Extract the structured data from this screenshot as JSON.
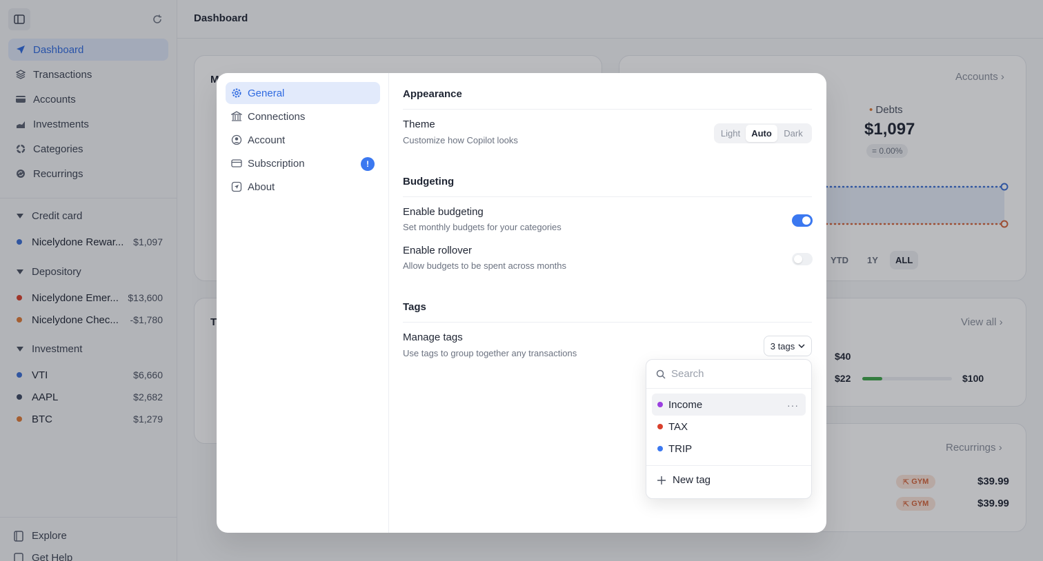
{
  "sidebar": {
    "nav": [
      {
        "label": "Dashboard",
        "active": true,
        "icon": "navigation-arrow-icon"
      },
      {
        "label": "Transactions",
        "active": false,
        "icon": "stack-icon"
      },
      {
        "label": "Accounts",
        "active": false,
        "icon": "card-icon"
      },
      {
        "label": "Investments",
        "active": false,
        "icon": "chart-icon"
      },
      {
        "label": "Categories",
        "active": false,
        "icon": "pie-icon"
      },
      {
        "label": "Recurrings",
        "active": false,
        "icon": "recurring-icon"
      }
    ],
    "groups": [
      {
        "label": "Credit card",
        "accounts": [
          {
            "name": "Nicelydone Rewar...",
            "amount": "$1,097",
            "color": "#3b6fd4"
          }
        ]
      },
      {
        "label": "Depository",
        "accounts": [
          {
            "name": "Nicelydone Emer...",
            "amount": "$13,600",
            "color": "#d9402c"
          },
          {
            "name": "Nicelydone Chec...",
            "amount": "-$1,780",
            "color": "#e07a35"
          }
        ]
      },
      {
        "label": "Investment",
        "accounts": [
          {
            "name": "VTI",
            "amount": "$6,660",
            "color": "#3b6fd4"
          },
          {
            "name": "AAPL",
            "amount": "$2,682",
            "color": "#3e4a63"
          },
          {
            "name": "BTC",
            "amount": "$1,279",
            "color": "#e07a35"
          }
        ]
      }
    ],
    "footer": [
      {
        "label": "Explore",
        "icon": "book-icon"
      },
      {
        "label": "Get Help",
        "icon": "help-icon"
      }
    ]
  },
  "header": {
    "title": "Dashboard"
  },
  "background": {
    "card1_title_fragment": "M",
    "card3_title_fragment": "T",
    "accounts_link": "Accounts",
    "debts_label": "Debts",
    "debts_value": "$1,097",
    "debts_change": "= 0.00%",
    "range_tabs": [
      "YTD",
      "1Y",
      "ALL"
    ],
    "view_all": "View all",
    "budget_values": [
      "$40",
      "$22",
      "$100"
    ],
    "recurrings_link": "Recurrings",
    "recurring_rows": [
      {
        "tag": "GYM",
        "amount": "$39.99"
      },
      {
        "tag": "GYM",
        "amount": "$39.99"
      }
    ]
  },
  "modal": {
    "menu": [
      {
        "label": "General",
        "active": true,
        "icon": "gear-icon"
      },
      {
        "label": "Connections",
        "active": false,
        "icon": "bank-icon"
      },
      {
        "label": "Account",
        "active": false,
        "icon": "user-circle-icon"
      },
      {
        "label": "Subscription",
        "active": false,
        "icon": "credit-card-icon",
        "badge": "!"
      },
      {
        "label": "About",
        "active": false,
        "icon": "app-icon"
      }
    ],
    "appearance": {
      "title": "Appearance",
      "theme_label": "Theme",
      "theme_desc": "Customize how Copilot looks",
      "theme_options": [
        "Light",
        "Auto",
        "Dark"
      ],
      "theme_selected": "Auto"
    },
    "budgeting": {
      "title": "Budgeting",
      "enable_label": "Enable budgeting",
      "enable_desc": "Set monthly budgets for your categories",
      "enable_on": true,
      "rollover_label": "Enable rollover",
      "rollover_desc": "Allow budgets to be spent across months",
      "rollover_on": false
    },
    "tags": {
      "title": "Tags",
      "manage_label": "Manage tags",
      "manage_desc": "Use tags to group together any transactions",
      "button_label": "3 tags"
    },
    "dropdown": {
      "search_placeholder": "Search",
      "items": [
        {
          "label": "Income",
          "color": "#9b3fe0"
        },
        {
          "label": "TAX",
          "color": "#d9402c"
        },
        {
          "label": "TRIP",
          "color": "#3b78f0"
        }
      ],
      "new_tag_label": "New tag"
    }
  },
  "colors": {
    "accent": "#2f6ae0",
    "toggle_on": "#3b78f0",
    "toggle_off": "#e6e8ec"
  }
}
